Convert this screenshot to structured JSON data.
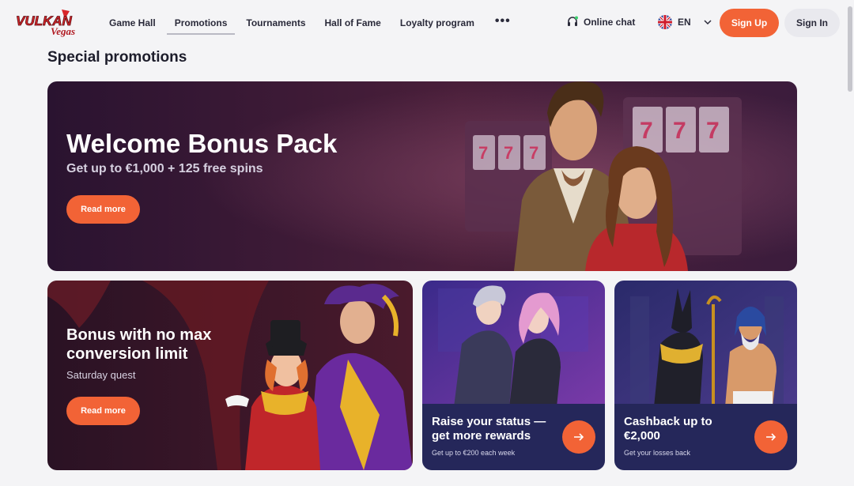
{
  "header": {
    "logo_text": "VULKAN",
    "logo_subtext": "Vegas",
    "nav": [
      "Game Hall",
      "Promotions",
      "Tournaments",
      "Hall of Fame",
      "Loyalty program"
    ],
    "more": "•••",
    "chat_label": "Online chat",
    "language": "EN",
    "signup_label": "Sign Up",
    "signin_label": "Sign In"
  },
  "page": {
    "title": "Special promotions"
  },
  "hero": {
    "title": "Welcome Bonus Pack",
    "subtitle": "Get up to €1,000 + 125 free spins",
    "button": "Read more"
  },
  "promo_conversion": {
    "title": "Bonus with no max conversion limit",
    "subtitle": "Saturday quest",
    "button": "Read more"
  },
  "promo_status": {
    "title": "Raise your status — get more rewards",
    "subtitle": "Get up to €200 each week"
  },
  "promo_cashback": {
    "title": "Cashback up to €2,000",
    "subtitle": "Get your losses back"
  },
  "colors": {
    "accent": "#f26336",
    "card_footer": "#25275a",
    "background": "#f4f4f6"
  }
}
